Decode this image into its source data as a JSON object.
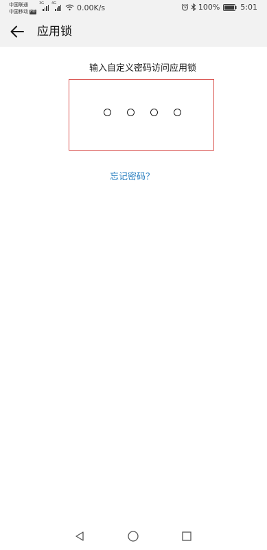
{
  "status_bar": {
    "carrier_1": "中国联通",
    "carrier_2": "中国移动",
    "hd_badge": "HD",
    "sim1_network": "3G",
    "sim2_network": "4G",
    "net_speed": "0.00K/s",
    "alarm_icon": "alarm-icon",
    "bluetooth_icon": "bluetooth-icon",
    "battery_percent": "100%",
    "battery_level": 1.0,
    "time": "5:01"
  },
  "app_bar": {
    "back_icon": "arrow-left-icon",
    "title": "应用锁"
  },
  "lock": {
    "prompt": "输入自定义密码访问应用锁",
    "pin_length": 4,
    "digits_entered": 0,
    "forgot_link": "忘记密码？",
    "highlight_color": "#d9534f",
    "link_color": "#2a7fc0"
  },
  "nav_bar": {
    "back_icon": "triangle-back-icon",
    "home_icon": "circle-home-icon",
    "recents_icon": "square-recents-icon"
  }
}
